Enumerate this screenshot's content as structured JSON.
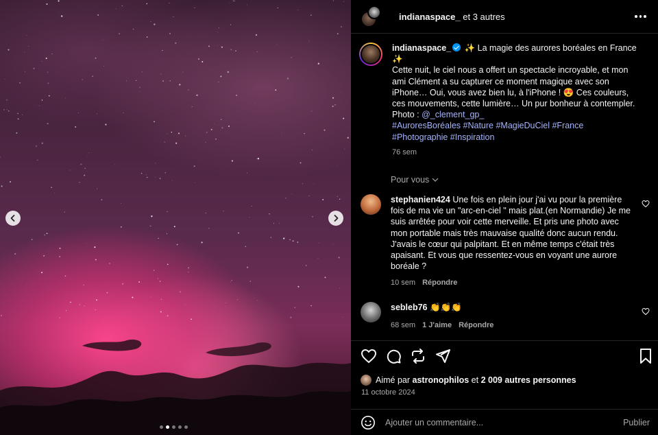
{
  "header": {
    "author": "indianaspace_",
    "collaborators_text": "et 3 autres"
  },
  "caption": {
    "username": "indianaspace_",
    "title_line": "✨ La magie des aurores boréales en France ✨",
    "body": "Cette nuit, le ciel nous a offert un spectacle incroyable, et mon ami Clément a su capturer ce moment magique avec son iPhone… Oui, vous avez bien lu, à l'iPhone ! 😍 Ces couleurs, ces mouvements, cette lumière… Un pur bonheur à contempler. Photo : ",
    "mention": "@_clement_gp_",
    "hashtags": "#AuroresBoréales #Nature #MagieDuCiel #France #Photographie #Inspiration",
    "time": "76 sem"
  },
  "pour_vous": "Pour vous",
  "comments": [
    {
      "username": "stephanien424",
      "text": "Une fois en plein jour j'ai vu pour la première fois de ma vie un \"arc-en-ciel \" mais plat.(en Normandie) Je me suis arrêtée pour voir cette merveille. Et pris une photo avec mon portable mais très mauvaise qualité donc aucun rendu. J'avais le cœur qui palpitant. Et en même temps c'était très apaisant. Et vous que ressentez-vous en voyant une aurore boréale ?",
      "time": "10 sem",
      "reply": "Répondre"
    },
    {
      "username": "sebleb76",
      "text": "👏👏👏",
      "time": "68 sem",
      "likes": "1 J'aime",
      "reply": "Répondre"
    }
  ],
  "likes": {
    "prefix": "Aimé par",
    "user": "astronophilos",
    "connector": "et",
    "others": "2 009 autres personnes"
  },
  "date": "11 octobre 2024",
  "composer": {
    "placeholder": "Ajouter un commentaire...",
    "publish": "Publier"
  },
  "carousel": {
    "slides": 5,
    "active_index": 1
  },
  "icons": [
    "chevron-left-icon",
    "chevron-right-icon",
    "more-icon",
    "heart-icon",
    "comment-icon",
    "repost-icon",
    "share-icon",
    "bookmark-icon",
    "emoji-icon",
    "chevron-down-icon",
    "verified-badge-icon"
  ],
  "colors": {
    "background": "#000000",
    "text": "#f5f5f5",
    "secondary": "#a8a8a8",
    "link": "#a5b4fc",
    "verified": "#0095f6"
  }
}
